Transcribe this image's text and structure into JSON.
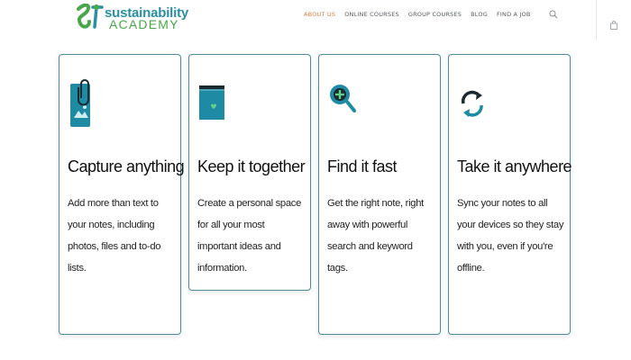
{
  "brand": {
    "line1": "sustainability",
    "line2": "ACADEMY",
    "primary": "#2a8fa3",
    "secondary": "#4aa64a"
  },
  "nav": {
    "items": [
      {
        "label": "ABOUT US",
        "active": true
      },
      {
        "label": "ONLINE COURSES"
      },
      {
        "label": "GROUP COURSES"
      },
      {
        "label": "BLOG"
      },
      {
        "label": "FIND A JOB"
      }
    ],
    "active_color": "#e07a3a",
    "search_icon": "search-icon",
    "cart_icon": "shopping-bag-icon"
  },
  "cards": [
    {
      "icon": "paperclip-photo-icon",
      "title": "Capture anything",
      "body": "Add more than text to your notes, including photos, files and to-do lists."
    },
    {
      "icon": "folder-heart-icon",
      "title": "Keep it together",
      "body": "Create a personal space for all your most important ideas and information."
    },
    {
      "icon": "magnifier-plus-icon",
      "title": "Find it fast",
      "body": "Get the right note, right away with powerful search and keyword tags."
    },
    {
      "icon": "sync-arrows-icon",
      "title": "Take it anywhere",
      "body": "Sync your notes to all your devices so they stay with you, even if you're offline."
    }
  ],
  "colors": {
    "card_border": "#4f8a98",
    "icon_teal": "#1e8aa3",
    "icon_dark": "#1b2a2e"
  }
}
